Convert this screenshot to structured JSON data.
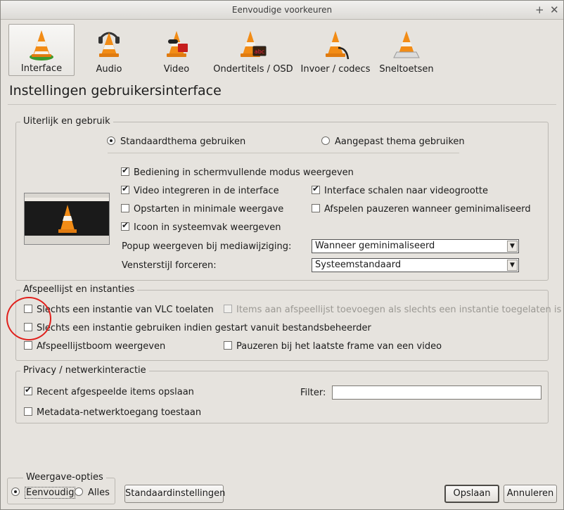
{
  "window": {
    "title": "Eenvoudige voorkeuren"
  },
  "toolbar": {
    "items": [
      {
        "label": "Interface",
        "icon": "vlc-interface-cone-icon"
      },
      {
        "label": "Audio",
        "icon": "vlc-audio-cone-icon"
      },
      {
        "label": "Video",
        "icon": "vlc-video-cone-icon"
      },
      {
        "label": "Ondertitels / OSD",
        "icon": "vlc-subtitles-cone-icon"
      },
      {
        "label": "Invoer / codecs",
        "icon": "vlc-input-cone-icon"
      },
      {
        "label": "Sneltoetsen",
        "icon": "vlc-hotkeys-cone-icon"
      }
    ]
  },
  "heading": "Instellingen gebruikersinterface",
  "appearance": {
    "title": "Uiterlijk en gebruik",
    "theme_native": "Standaardthema gebruiken",
    "theme_custom": "Aangepast thema gebruiken",
    "fullscreen_controls": "Bediening in schermvullende modus weergeven",
    "embed_video": "Video integreren in de interface",
    "resize_interface": "Interface schalen naar videogrootte",
    "start_minimal": "Opstarten in minimale weergave",
    "pause_minimized": "Afspelen pauzeren wanneer geminimaliseerd",
    "systray_icon": "Icoon in systeemvak weergeven",
    "popup_label": "Popup weergeven bij mediawijziging:",
    "popup_value": "Wanneer geminimaliseerd",
    "style_label": "Vensterstijl forceren:",
    "style_value": "Systeemstandaard"
  },
  "playlist": {
    "title": "Afspeellijst en instanties",
    "one_instance": "Slechts een instantie van VLC toelaten",
    "enqueue": "Items aan afspeellijst toevoegen als slechts een instantie toegelaten is",
    "one_instance_filemanager": "Slechts een instantie gebruiken indien gestart vanuit bestandsbeheerder",
    "tree": "Afspeellijstboom weergeven",
    "pause_last_frame": "Pauzeren bij het laatste frame van een video"
  },
  "privacy": {
    "title": "Privacy / netwerkinteractie",
    "recent": "Recent afgespeelde items opslaan",
    "filter_label": "Filter:",
    "filter_value": "",
    "metadata": "Metadata-netwerktoegang toestaan"
  },
  "footer": {
    "view_title": "Weergave-opties",
    "simple": "Eenvoudig",
    "all": "Alles",
    "reset": "Standaardinstellingen",
    "save": "Opslaan",
    "cancel": "Annuleren"
  }
}
